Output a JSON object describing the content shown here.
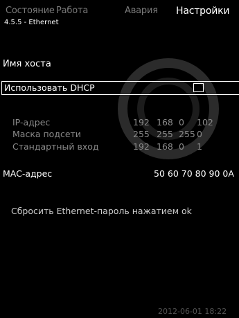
{
  "tabs": [
    {
      "label": "Состояние",
      "active": false
    },
    {
      "label": "Работа",
      "active": false
    },
    {
      "label": "Авария",
      "active": false
    },
    {
      "label": "Настройки",
      "active": true
    }
  ],
  "subtitle": "4.5.5 - Ethernet",
  "hostname_label": "Имя хоста",
  "dhcp": {
    "label": "Использовать DHCP",
    "checked": false
  },
  "network": {
    "ip": {
      "label": "IP-адрес",
      "octets": [
        "192",
        "168",
        "0",
        "102"
      ]
    },
    "mask": {
      "label": "Маска подсети",
      "octets": [
        "255",
        "255",
        "255",
        "0"
      ]
    },
    "gateway": {
      "label": "Стандартный вход",
      "octets": [
        "192",
        "168",
        "0",
        "1"
      ]
    }
  },
  "mac": {
    "label": "MAC-адрес",
    "value": "50 60 70   80 90 0A"
  },
  "reset_text": "Сбросить Ethernet-пароль нажатием ok",
  "datetime": "2012-06-01 18:22",
  "colors": {
    "background": "#000000",
    "text": "#ffffff",
    "inactive": "#7a7a7a",
    "values": "#8a8a8a"
  },
  "icons": {
    "watermark": "grundfos-logo-watermark"
  }
}
